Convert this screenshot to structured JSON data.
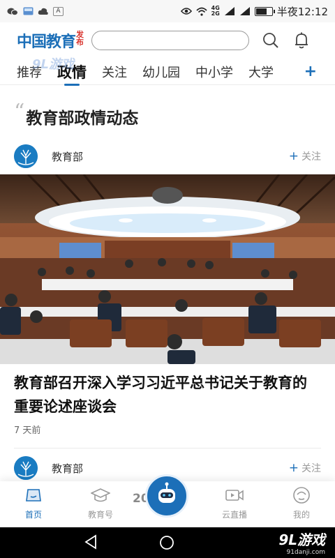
{
  "status_bar": {
    "notif_badge": "A",
    "network_top": "4G",
    "network_bottom": "2G",
    "battery_level": 0.7,
    "time": "半夜12:12"
  },
  "header": {
    "logo_main": "中国教育",
    "logo_sub": "发布",
    "search_placeholder": ""
  },
  "tabs": [
    {
      "label": "推荐"
    },
    {
      "label": "政情"
    },
    {
      "label": "关注"
    },
    {
      "label": "幼儿园"
    },
    {
      "label": "中小学"
    },
    {
      "label": "大学"
    }
  ],
  "tab_more": "+",
  "active_tab_index": 1,
  "watermark_top": "9L游戏",
  "section_title": "教育部政情动态",
  "feed": [
    {
      "author": "教育部",
      "follow_label": "关注",
      "title": "教育部召开深入学习习近平总书记关于教育的重要论述座谈会",
      "time": "7 天前"
    },
    {
      "author": "教育部",
      "follow_label": "关注"
    }
  ],
  "bottom_nav": [
    {
      "label": "首页",
      "icon": "home-icon"
    },
    {
      "label": "教育号",
      "icon": "graduation-cap-icon"
    },
    {
      "label": "",
      "icon": "robot-icon"
    },
    {
      "label": "云直播",
      "icon": "video-icon"
    },
    {
      "label": "我的",
      "icon": "person-icon"
    }
  ],
  "float_overlay_text": "20 国",
  "watermark_bottom": {
    "brand": "9L游戏",
    "url": "91danji.com"
  },
  "colors": {
    "brand_blue": "#1c6fb8",
    "logo_red": "#d8322c"
  }
}
